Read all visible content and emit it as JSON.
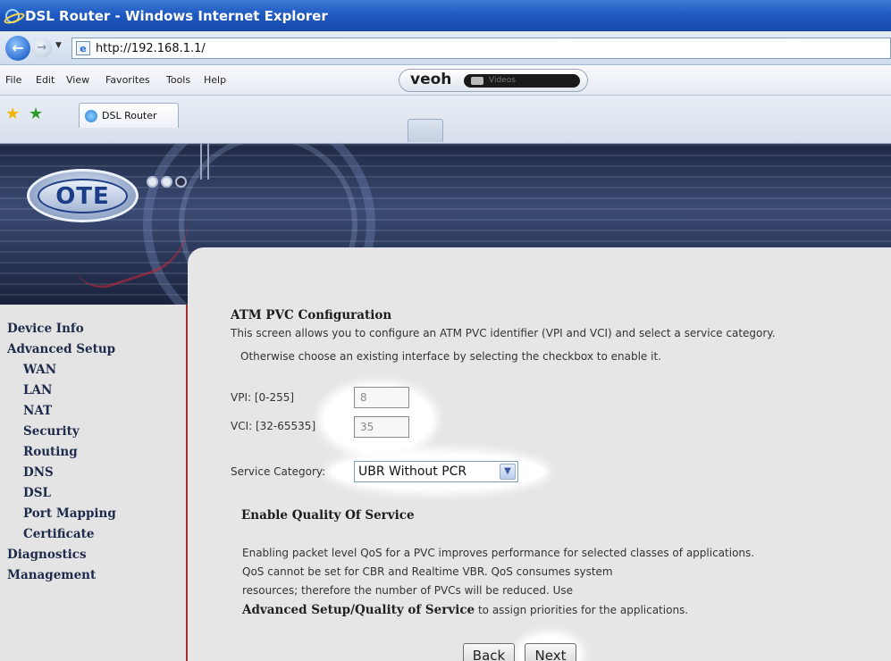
{
  "window": {
    "title": "DSL Router - Windows Internet Explorer"
  },
  "address": {
    "url": "http://192.168.1.1/"
  },
  "menu": [
    "File",
    "Edit",
    "View",
    "Favorites",
    "Tools",
    "Help"
  ],
  "toolbar": {
    "veoh_logo": "veoh",
    "veoh_videos": "Videos"
  },
  "tabs": {
    "active": "DSL Router"
  },
  "banner": {
    "logo_text": "OTE"
  },
  "sidebar": {
    "items": [
      {
        "label": "Device Info"
      },
      {
        "label": "Advanced Setup"
      },
      {
        "label": "WAN"
      },
      {
        "label": "LAN"
      },
      {
        "label": "NAT"
      },
      {
        "label": "Security"
      },
      {
        "label": "Routing"
      },
      {
        "label": "DNS"
      },
      {
        "label": "DSL"
      },
      {
        "label": "Port Mapping"
      },
      {
        "label": "Certificate"
      },
      {
        "label": "Diagnostics"
      },
      {
        "label": "Management"
      }
    ]
  },
  "main": {
    "title": "ATM PVC Configuration",
    "desc_line1": "This screen allows you to configure an ATM PVC identifier (VPI and VCI) and select a service category.",
    "desc_line2": "Otherwise choose an existing interface by selecting the checkbox to     enable it.",
    "vpi_label": "VPI: [0-255]",
    "vpi_value": "8",
    "vci_label": "VCI: [32-65535]",
    "vci_value": "35",
    "service_label": "Service Category:",
    "service_value": "UBR Without PCR",
    "qos_title": "Enable Quality Of Service",
    "qos_line1": "Enabling packet level QoS for a PVC improves performance for selected classes of applications.",
    "qos_line2": "QoS cannot be set for CBR and Realtime VBR.  QoS consumes system",
    "qos_line3": "resources; therefore the number of PVCs will be reduced. Use",
    "qos_line4_bold": "Advanced Setup/Quality of Service",
    "qos_line4_rest": " to assign priorities for the applications.",
    "back_label": "Back",
    "next_label": "Next"
  }
}
